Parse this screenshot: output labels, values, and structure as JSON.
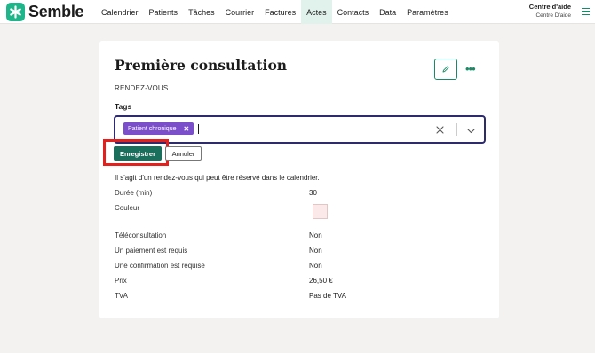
{
  "app": {
    "logo_text": "Semble",
    "brand_color": "#1fb58a",
    "accent_color": "#1a8a66"
  },
  "nav": {
    "items": [
      {
        "label": "Calendrier"
      },
      {
        "label": "Patients"
      },
      {
        "label": "Tâches"
      },
      {
        "label": "Courrier"
      },
      {
        "label": "Factures"
      },
      {
        "label": "Actes",
        "active": true
      },
      {
        "label": "Contacts"
      },
      {
        "label": "Data"
      },
      {
        "label": "Paramètres"
      }
    ]
  },
  "help": {
    "title": "Centre d'aide",
    "subtitle": "Centre D'aide"
  },
  "page": {
    "title": "Première consultation",
    "type": "RENDEZ-VOUS"
  },
  "tags": {
    "label": "Tags",
    "selected": [
      {
        "label": "Patient chronique",
        "color": "#7b4fc9"
      }
    ]
  },
  "actions": {
    "save_label": "Enregistrer",
    "cancel_label": "Annuler"
  },
  "details": {
    "description": "Il s'agit d'un rendez-vous qui peut être réservé dans le calendrier.",
    "duration": {
      "label": "Durée (min)",
      "value": "30"
    },
    "color": {
      "label": "Couleur",
      "value": "#fbe9e9"
    },
    "teleconsultation": {
      "label": "Téléconsultation",
      "value": "Non"
    },
    "payment_required": {
      "label": "Un paiement est requis",
      "value": "Non"
    },
    "confirmation_required": {
      "label": "Une confirmation est requise",
      "value": "Non"
    },
    "price": {
      "label": "Prix",
      "value": "26,50 €"
    },
    "vat": {
      "label": "TVA",
      "value": "Pas de TVA"
    }
  }
}
